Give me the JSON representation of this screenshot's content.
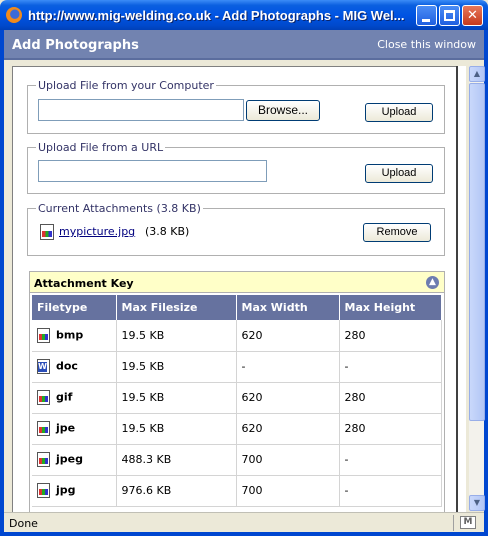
{
  "window": {
    "title": "http://www.mig-welding.co.uk - Add Photographs - MIG Wel..."
  },
  "header": {
    "title": "Add Photographs",
    "close_label": "Close this window"
  },
  "upload_computer": {
    "legend": "Upload File from your Computer",
    "file_value": "",
    "browse_label": "Browse...",
    "upload_label": "Upload"
  },
  "upload_url": {
    "legend": "Upload File from a URL",
    "url_value": "",
    "upload_label": "Upload"
  },
  "attachments": {
    "legend": "Current Attachments (3.8 KB)",
    "items": [
      {
        "name": "mypicture.jpg",
        "size": "(3.8 KB)",
        "icon": "image-file-icon",
        "remove_label": "Remove"
      }
    ]
  },
  "attachment_key": {
    "title": "Attachment Key",
    "columns": [
      "Filetype",
      "Max Filesize",
      "Max Width",
      "Max Height"
    ],
    "rows": [
      {
        "type": "bmp",
        "icon": "image-file-icon",
        "max_filesize": "19.5 KB",
        "max_width": "620",
        "max_height": "280"
      },
      {
        "type": "doc",
        "icon": "word-document-icon",
        "max_filesize": "19.5 KB",
        "max_width": "-",
        "max_height": "-"
      },
      {
        "type": "gif",
        "icon": "image-file-icon",
        "max_filesize": "19.5 KB",
        "max_width": "620",
        "max_height": "280"
      },
      {
        "type": "jpe",
        "icon": "image-file-icon",
        "max_filesize": "19.5 KB",
        "max_width": "620",
        "max_height": "280"
      },
      {
        "type": "jpeg",
        "icon": "image-file-icon",
        "max_filesize": "488.3 KB",
        "max_width": "700",
        "max_height": "-"
      },
      {
        "type": "jpg",
        "icon": "image-file-icon",
        "max_filesize": "976.6 KB",
        "max_width": "700",
        "max_height": "-"
      }
    ]
  },
  "status_bar": {
    "text": "Done"
  },
  "colors": {
    "header_bg": "#7283b0",
    "table_header_bg": "#66729f",
    "key_title_bg": "#ffffc8",
    "link": "#00007f"
  }
}
